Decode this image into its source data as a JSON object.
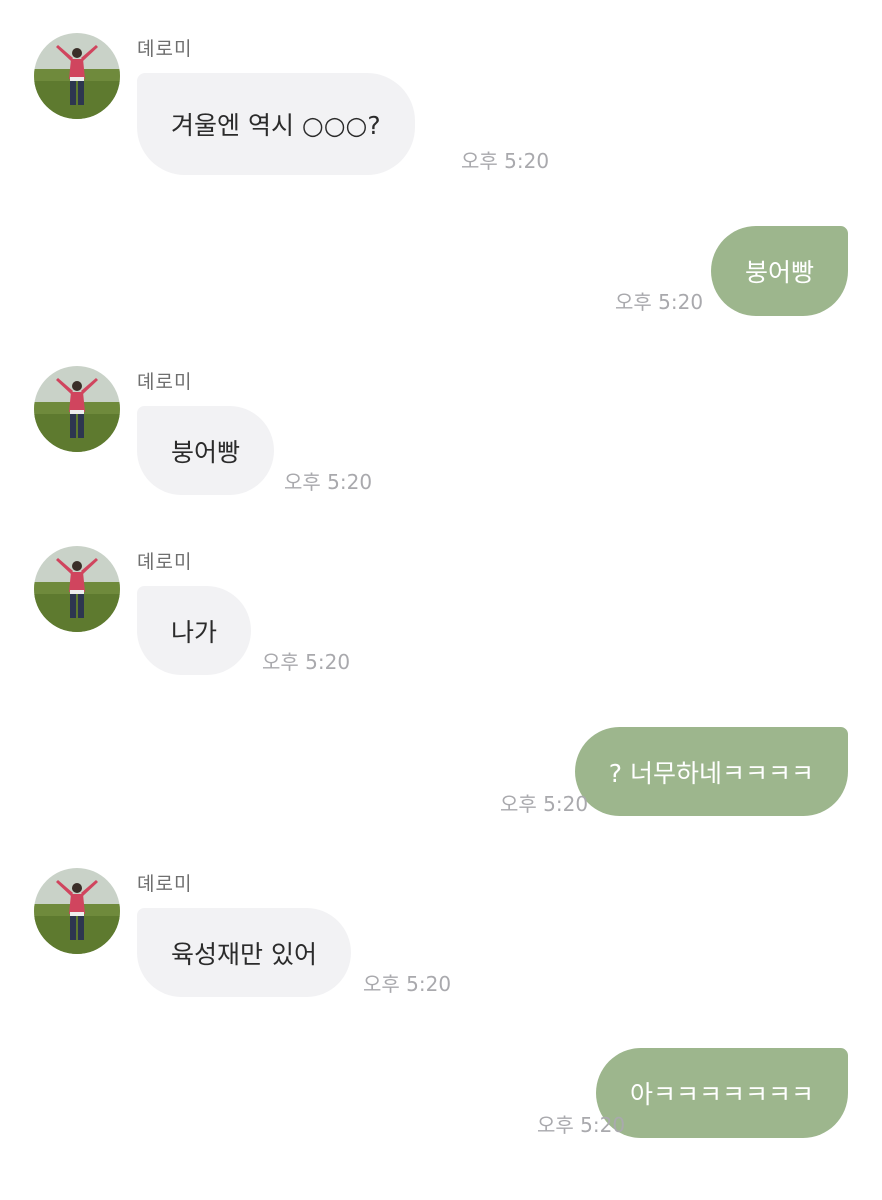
{
  "chat": {
    "messages": [
      {
        "direction": "incoming",
        "sender": "뎨로미",
        "text": "겨울엔 역시 ○○○?",
        "time": "오후 5:20"
      },
      {
        "direction": "outgoing",
        "text": "붕어빵",
        "time": "오후 5:20"
      },
      {
        "direction": "incoming",
        "sender": "뎨로미",
        "text": "붕어빵",
        "time": "오후 5:20"
      },
      {
        "direction": "incoming",
        "sender": "뎨로미",
        "text": "나가",
        "time": "오후 5:20"
      },
      {
        "direction": "outgoing",
        "text": "? 너무하네ㅋㅋㅋㅋ",
        "time": "오후 5:20"
      },
      {
        "direction": "incoming",
        "sender": "뎨로미",
        "text": "육성재만 있어",
        "time": "오후 5:20"
      },
      {
        "direction": "outgoing",
        "text": "아ㅋㅋㅋㅋㅋㅋㅋ",
        "time": "오후 5:20"
      }
    ]
  },
  "colors": {
    "incoming_bubble": "#f2f2f4",
    "outgoing_bubble": "#9db68d",
    "timestamp": "#a9a9ad",
    "sender_name": "#6f6f6f"
  }
}
